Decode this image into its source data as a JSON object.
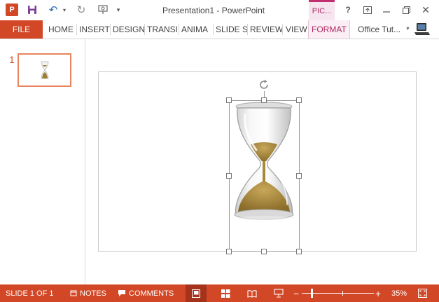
{
  "title_bar": {
    "app_logo": "P",
    "window_title": "Presentation1 - PowerPoint",
    "contextual_tab": "PIC...",
    "help": "?",
    "close": "✕"
  },
  "ribbon": {
    "file_tab": "FILE",
    "tabs": [
      "HOME",
      "INSERT",
      "DESIGN",
      "TRANSI",
      "ANIMA",
      "SLIDE S",
      "REVIEW",
      "VIEW",
      "FORMAT"
    ],
    "active_tab": "FORMAT",
    "account_name": "Office Tut..."
  },
  "thumbnails": {
    "items": [
      {
        "number": "1"
      }
    ]
  },
  "status_bar": {
    "slide_counter": "SLIDE 1 OF 1",
    "notes": "NOTES",
    "comments": "COMMENTS",
    "zoom_level": "35%",
    "zoom_slider_value": 0.14
  },
  "icons": [
    "powerpoint-logo-icon",
    "save-icon",
    "undo-icon",
    "redo-icon",
    "present-icon",
    "customize-qat-icon",
    "ribbon-display-icon",
    "minimize-icon",
    "restore-icon",
    "close-icon",
    "account-avatar-icon",
    "rotate-icon",
    "notes-icon",
    "comments-icon",
    "normal-view-icon",
    "slide-sorter-icon",
    "reading-view-icon",
    "slideshow-icon",
    "fit-to-window-icon"
  ],
  "colors": {
    "accent": "#d24726",
    "picture_tools": "#b02a63",
    "sand": "#a8893a"
  }
}
